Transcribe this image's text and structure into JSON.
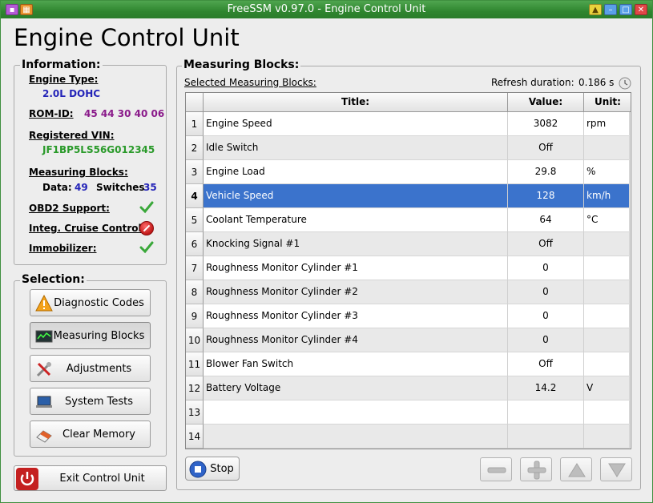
{
  "window": {
    "title": "FreeSSM v0.97.0 - Engine Control Unit"
  },
  "page_title": "Engine Control Unit",
  "information": {
    "title": "Information:",
    "engine_type_label": "Engine Type:",
    "engine_type_value": "2.0L DOHC",
    "rom_id_label": "ROM-ID:",
    "rom_id_value": "45 44 30 40 06",
    "vin_label": "Registered VIN:",
    "vin_value": "JF1BP5LS56G012345",
    "mb_label": "Measuring Blocks:",
    "data_label": "Data:",
    "data_value": "49",
    "switches_label": "Switches",
    "switches_value": "35",
    "obd2_label": "OBD2 Support:",
    "cruise_label": "Integ. Cruise Control:",
    "immobilizer_label": "Immobilizer:"
  },
  "selection": {
    "title": "Selection:",
    "buttons": [
      "Diagnostic Codes",
      "Measuring Blocks",
      "Adjustments",
      "System Tests",
      "Clear Memory"
    ]
  },
  "exit_label": "Exit Control Unit",
  "measuring": {
    "title": "Measuring Blocks:",
    "selected_label": "Selected Measuring Blocks:",
    "refresh_label": "Refresh duration:",
    "refresh_value": "0.186 s",
    "headers": {
      "title": "Title:",
      "value": "Value:",
      "unit": "Unit:"
    },
    "rows": [
      {
        "n": "1",
        "title": "Engine Speed",
        "value": "3082",
        "unit": "rpm"
      },
      {
        "n": "2",
        "title": "Idle Switch",
        "value": "Off",
        "unit": ""
      },
      {
        "n": "3",
        "title": "Engine Load",
        "value": "29.8",
        "unit": "%"
      },
      {
        "n": "4",
        "title": "Vehicle Speed",
        "value": "128",
        "unit": "km/h"
      },
      {
        "n": "5",
        "title": "Coolant Temperature",
        "value": "64",
        "unit": "°C"
      },
      {
        "n": "6",
        "title": "Knocking Signal #1",
        "value": "Off",
        "unit": ""
      },
      {
        "n": "7",
        "title": "Roughness Monitor Cylinder #1",
        "value": "0",
        "unit": ""
      },
      {
        "n": "8",
        "title": "Roughness Monitor Cylinder #2",
        "value": "0",
        "unit": ""
      },
      {
        "n": "9",
        "title": "Roughness Monitor Cylinder #3",
        "value": "0",
        "unit": ""
      },
      {
        "n": "10",
        "title": "Roughness Monitor Cylinder #4",
        "value": "0",
        "unit": ""
      },
      {
        "n": "11",
        "title": "Blower Fan Switch",
        "value": "Off",
        "unit": ""
      },
      {
        "n": "12",
        "title": "Battery Voltage",
        "value": "14.2",
        "unit": "V"
      },
      {
        "n": "13",
        "title": "",
        "value": "",
        "unit": ""
      },
      {
        "n": "14",
        "title": "",
        "value": "",
        "unit": ""
      }
    ],
    "stop_label": "Stop"
  }
}
